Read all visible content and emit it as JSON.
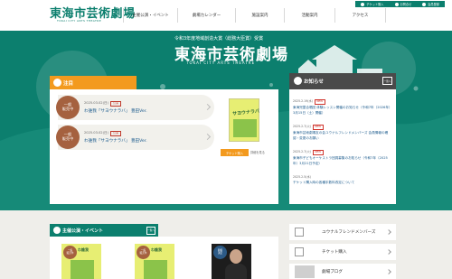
{
  "header": {
    "logo_text": "東海市芸術劇場",
    "logo_subtext": "TOKAI CITY ARTS THEATRE",
    "util_links": [
      {
        "label": "チケット購入",
        "icon": "ticket-icon"
      },
      {
        "label": "お問合せ",
        "icon": "mail-icon"
      },
      {
        "label": "会員登録",
        "icon": "user-icon"
      }
    ],
    "nav": [
      {
        "label": "主催公演・イベント"
      },
      {
        "label": "劇場カレンダー"
      },
      {
        "label": "施設案内"
      },
      {
        "label": "活動案内"
      },
      {
        "label": "アクセス"
      }
    ]
  },
  "hero": {
    "award": "令和3年度地域創造大賞（総務大臣賞）受賞",
    "title": "東海市芸術劇場",
    "title_en": "TOKAI CITY ARTS THEATRE"
  },
  "pickup": {
    "heading": "注目",
    "items": [
      {
        "badge": "一般\n販売中",
        "date": "2025.03.02(日)",
        "tag": "公演",
        "title": "わ誰我「サヨウナラバ」 豊田Ver."
      },
      {
        "badge": "一般\n販売中",
        "date": "2025.03.02(日)",
        "tag": "公演",
        "title": "わ誰我「サヨウナラバ」 豊田Ver."
      }
    ],
    "poster_title": "サヨウナラバ",
    "ticket_button": "チケット購入",
    "detail_link": "詳細を見る"
  },
  "news": {
    "heading": "お知らせ",
    "list_button": "一覧へ",
    "items": [
      {
        "date": "2025.2.19(水)",
        "is_new": true,
        "title": "東海児童合唱団 体験レッスン開催のお知らせ（令和7年（2026年）3月15日（土）開催）"
      },
      {
        "date": "2025.2.7(火)",
        "is_new": true,
        "title": "東海市芸術劇場友の会ユウナルフレンドメンバーズ 会員情報の確認・変更のお願い"
      },
      {
        "date": "2025.2.7(火)",
        "is_new": true,
        "title": "東海市子どもオーケストラ団員募集のお知らせ（令和7年（2025年）3月21日予定）"
      },
      {
        "date": "2025.2.5(水)",
        "is_new": false,
        "title": "チケット購入時の各種手数料改定について"
      }
    ]
  },
  "events": {
    "heading": "主催公演・イベント",
    "list_button": "一覧へ",
    "cards": [
      {
        "badge": "一般\n販売中",
        "title": "わ誰我"
      },
      {
        "badge": "一般\n販売中",
        "title": "わ誰我"
      },
      {
        "badge": "開催\n決定"
      }
    ]
  },
  "side_links": [
    {
      "label": "ユウナルフレンドメンバーズ"
    },
    {
      "label": "チケット購入"
    },
    {
      "label": "劇場ブログ"
    }
  ],
  "colors": {
    "teal": "#0c7f6e",
    "orange": "#f39a1e",
    "badge_brown": "#a5613f",
    "news_dark": "#4a4a4a"
  }
}
